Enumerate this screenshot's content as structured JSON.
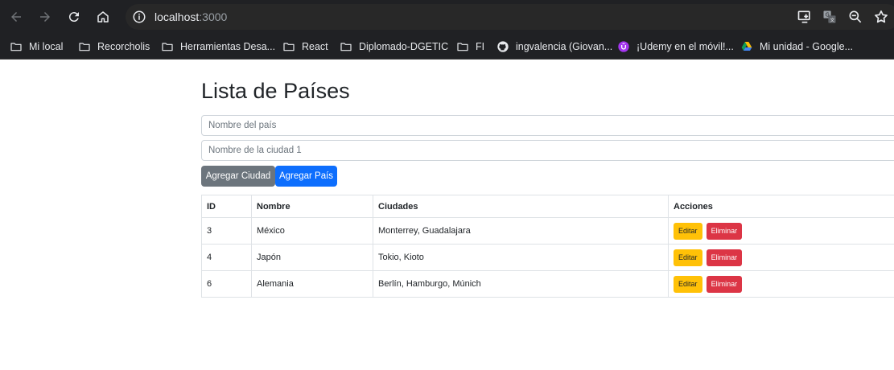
{
  "browser": {
    "url_host": "localhost",
    "url_port": ":3000",
    "bookmarks": [
      {
        "label": "Mi local",
        "icon": "folder-icon"
      },
      {
        "label": "Recorcholis",
        "icon": "folder-icon"
      },
      {
        "label": "Herramientas Desa...",
        "icon": "folder-icon"
      },
      {
        "label": "React",
        "icon": "folder-icon"
      },
      {
        "label": "Diplomado-DGETIC",
        "icon": "folder-icon"
      },
      {
        "label": "FI",
        "icon": "folder-icon"
      },
      {
        "label": "ingvalencia (Giovan...",
        "icon": "github-icon"
      },
      {
        "label": "¡Udemy en el móvil!...",
        "icon": "udemy-icon"
      },
      {
        "label": "Mi unidad - Google...",
        "icon": "google-drive-icon"
      }
    ]
  },
  "page": {
    "title": "Lista de Países",
    "country_placeholder": "Nombre del país",
    "city_placeholder": "Nombre de la ciudad 1",
    "add_city_label": "Agregar Ciudad",
    "add_country_label": "Agregar País"
  },
  "table": {
    "headers": [
      "ID",
      "Nombre",
      "Ciudades",
      "Acciones"
    ],
    "rows": [
      {
        "id": "3",
        "name": "México",
        "cities": "Monterrey, Guadalajara"
      },
      {
        "id": "4",
        "name": "Japón",
        "cities": "Tokio, Kioto"
      },
      {
        "id": "6",
        "name": "Alemania",
        "cities": "Berlín, Hamburgo, Múnich"
      }
    ],
    "edit_label": "Editar",
    "delete_label": "Eliminar"
  },
  "colors": {
    "chrome_bg": "#202124",
    "primary": "#0d6efd",
    "secondary": "#6c757d",
    "warning": "#ffc107",
    "danger": "#dc3545"
  }
}
